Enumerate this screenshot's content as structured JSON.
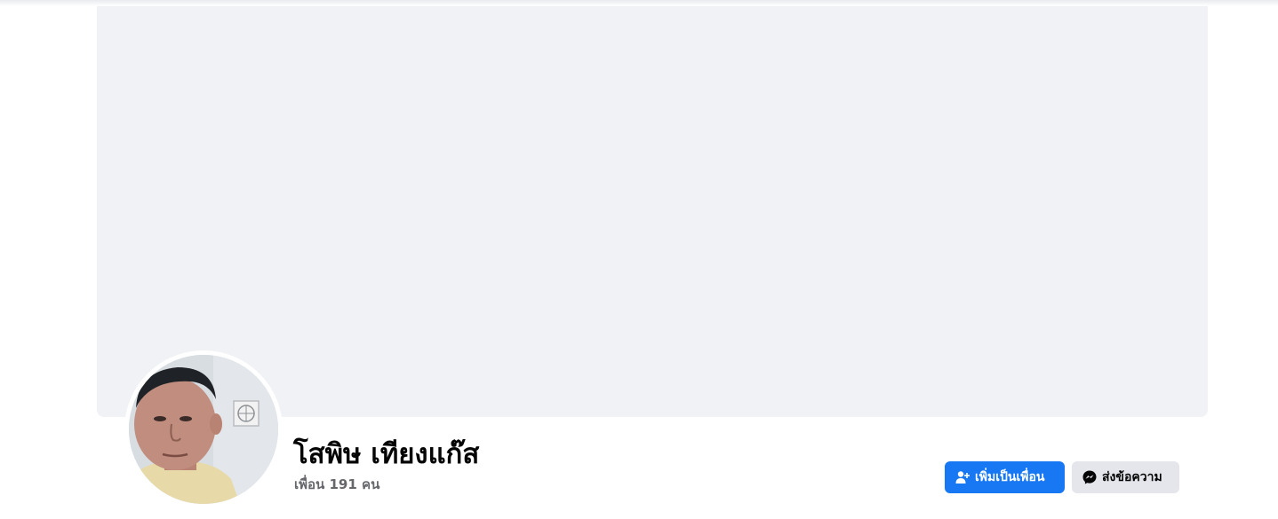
{
  "profile": {
    "name": "โสพิษ เทียงแก๊ส",
    "friends_count_text": "เพื่อน 191 คน"
  },
  "actions": {
    "add_friend_label": "เพิ่มเป็นเพื่อน",
    "add_friend_icon": "add-friend-icon",
    "message_label": "ส่งข้อความ",
    "message_icon": "messenger-icon"
  },
  "colors": {
    "primary": "#1877f2",
    "secondary_button": "#e4e6eb",
    "cover_placeholder": "#f0f2f5",
    "muted_text": "#65676b"
  }
}
